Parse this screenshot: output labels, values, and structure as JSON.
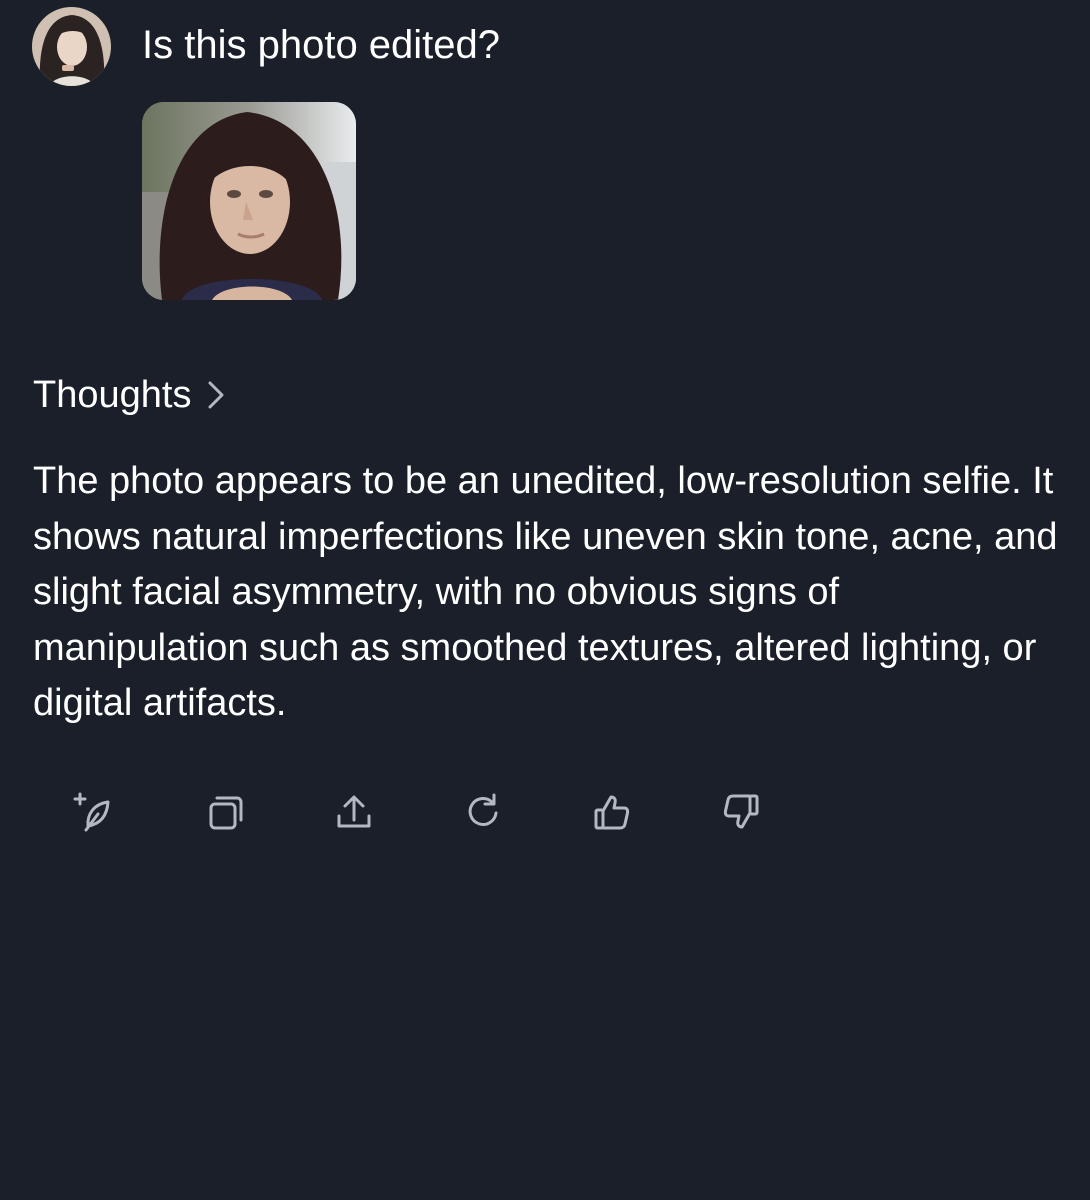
{
  "message": {
    "question": "Is this photo edited?",
    "user_avatar_icon": "user-avatar",
    "attached_image_icon": "selfie-photo-thumbnail"
  },
  "response": {
    "thoughts_label": "Thoughts",
    "thoughts_icon": "chevron-right-icon",
    "answer_text": "The photo appears to be an unedited, low-resolution selfie. It shows natural imperfections like uneven skin tone, acne, and slight facial asymmetry, with no obvious signs of manipulation such as smoothed textures, altered lighting, or digital artifacts."
  },
  "actions": [
    {
      "icon": "edit-sparkle-icon"
    },
    {
      "icon": "copy-icon"
    },
    {
      "icon": "share-icon"
    },
    {
      "icon": "regenerate-icon"
    },
    {
      "icon": "thumbs-up-icon"
    },
    {
      "icon": "thumbs-down-icon"
    }
  ],
  "colors": {
    "background": "#1a1f29",
    "text": "#ffffff",
    "icon": "#b3b8c2"
  }
}
